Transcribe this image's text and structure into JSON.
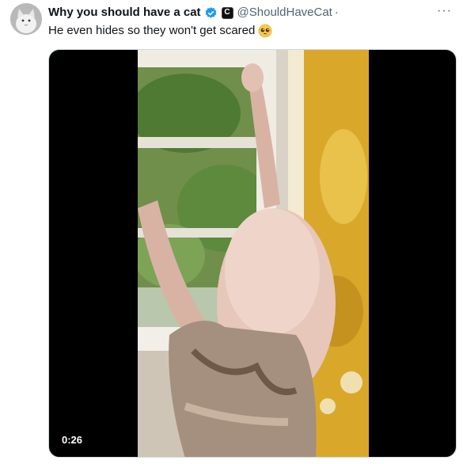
{
  "tweet": {
    "display_name": "Why you should have a cat",
    "handle": "@ShouldHaveCat",
    "separator": "·",
    "affiliate_letter": "C",
    "text": "He even hides so they won't get scared",
    "more_label": "···",
    "avatar_icon": "cat-avatar",
    "verified_icon": "verified-badge-icon",
    "emoji_icon": "pleading-face-emoji"
  },
  "video": {
    "duration": "0:26"
  },
  "colors": {
    "verified": "#1d9bf0",
    "muted_text": "#536471",
    "video_background": "#000000"
  }
}
